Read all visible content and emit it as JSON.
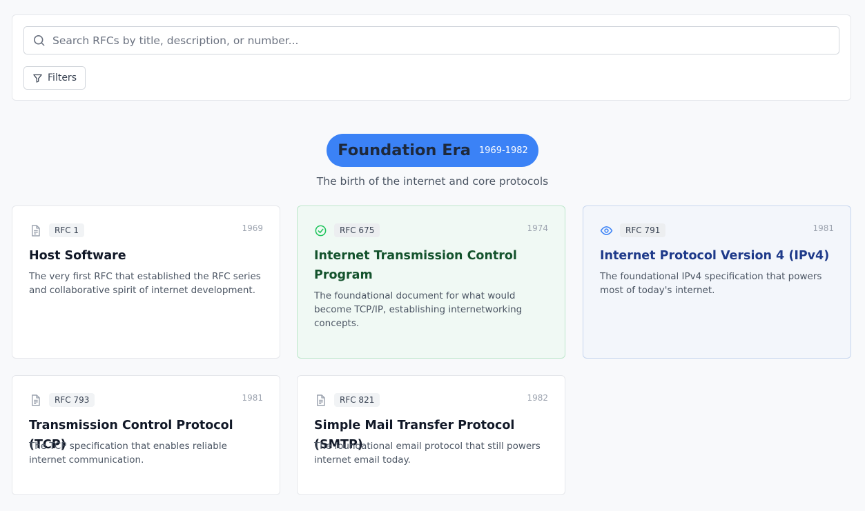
{
  "search": {
    "placeholder": "Search RFCs by title, description, or number...",
    "value": ""
  },
  "filters": {
    "label": "Filters"
  },
  "era": {
    "title": "Foundation Era",
    "years": "1969-1982",
    "subtitle": "The birth of the internet and core protocols"
  },
  "colors": {
    "accent": "#3b82f6",
    "green_icon": "#22c55e",
    "blue_icon": "#3b82f6",
    "doc_icon": "#9ca3af"
  },
  "cards": [
    {
      "icon": "document-icon",
      "rfc": "RFC 1",
      "year": "1969",
      "title": "Host Software",
      "description": "The very first RFC that established the RFC series and collaborative spirit of internet development."
    },
    {
      "icon": "check-circle-icon",
      "rfc": "RFC 675",
      "year": "1974",
      "title": "Internet Transmission Control Program",
      "description": "The foundational document for what would become TCP/IP, establishing internetworking concepts."
    },
    {
      "icon": "eye-icon",
      "rfc": "RFC 791",
      "year": "1981",
      "title": "Internet Protocol Version 4 (IPv4)",
      "description": "The foundational IPv4 specification that powers most of today's internet."
    },
    {
      "icon": "document-icon",
      "rfc": "RFC 793",
      "year": "1981",
      "title": "Transmission Control Protocol (TCP)",
      "description": "The TCP specification that enables reliable internet communication."
    },
    {
      "icon": "document-icon",
      "rfc": "RFC 821",
      "year": "1982",
      "title": "Simple Mail Transfer Protocol (SMTP)",
      "description": "The foundational email protocol that still powers internet email today."
    }
  ]
}
